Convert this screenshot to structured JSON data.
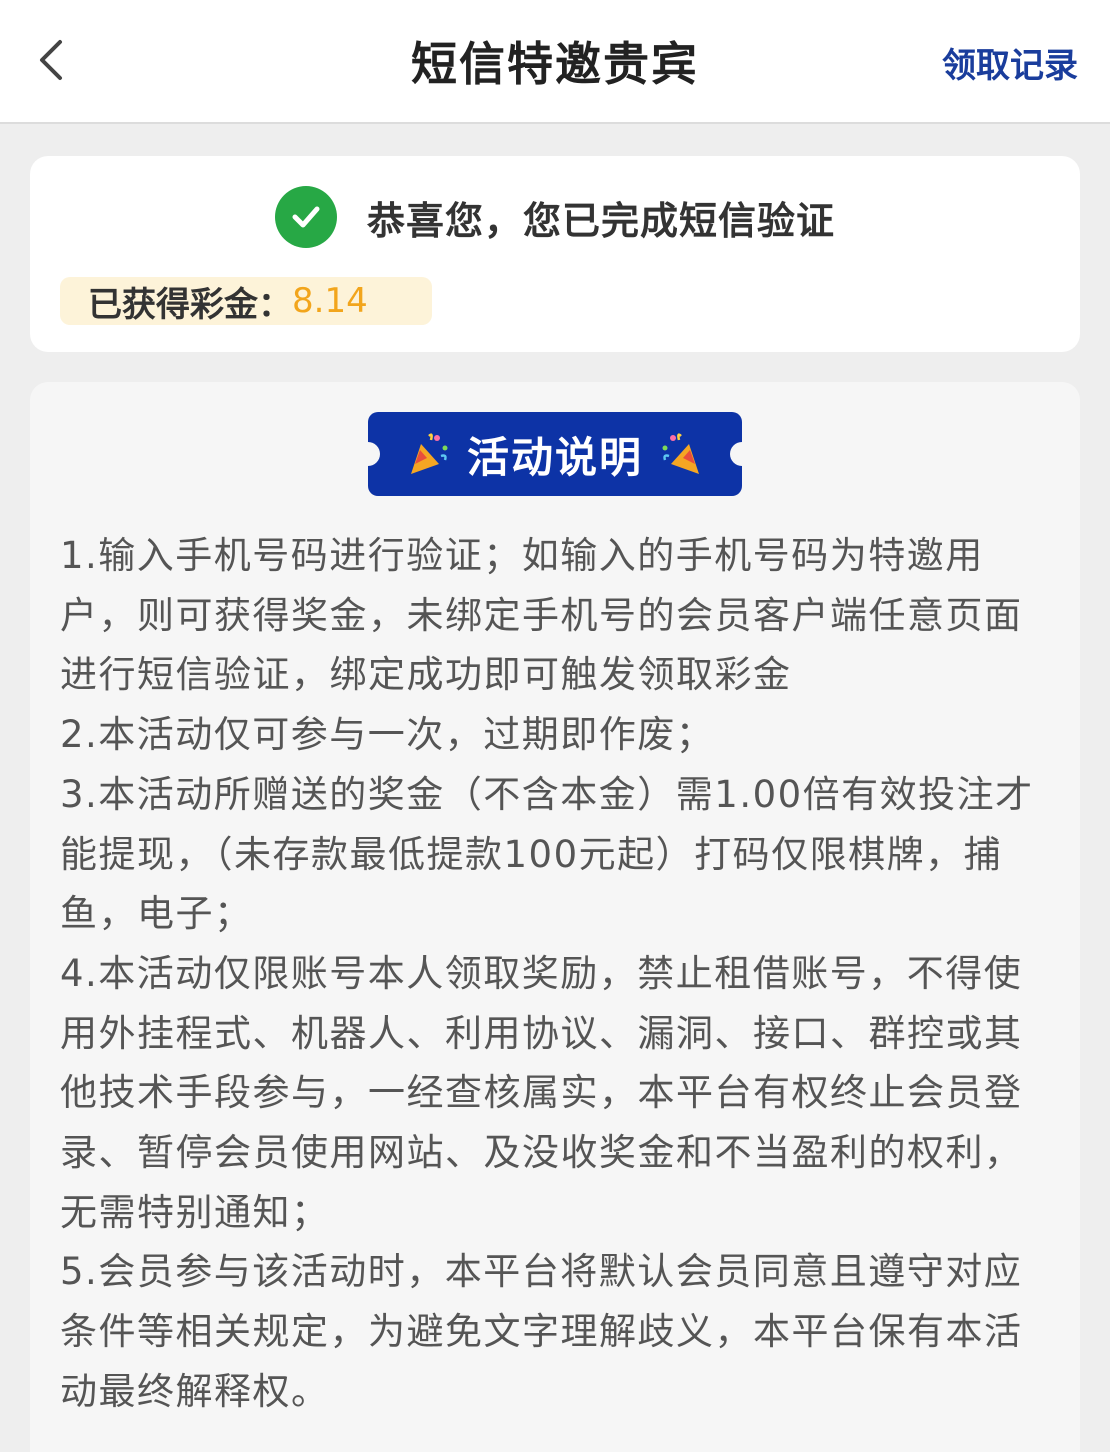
{
  "header": {
    "title": "短信特邀贵宾",
    "records_label": "领取记录",
    "back_icon": "chevron-left-icon"
  },
  "success": {
    "icon": "check-circle-icon",
    "message": "恭喜您，您已完成短信验证",
    "bonus_label": "已获得彩金：",
    "bonus_value": "8.14"
  },
  "rules": {
    "badge_label": "活动说明",
    "badge_icon": "party-popper-icon",
    "items": [
      "1.输入手机号码进行验证；如输入的手机号码为特邀用户，则可获得奖金，未绑定手机号的会员客户端任意页面进行短信验证，绑定成功即可触发领取彩金",
      "2.本活动仅可参与一次，过期即作废；",
      "3.本活动所赠送的奖金（不含本金）需1.00倍有效投注才能提现，（未存款最低提款100元起）打码仅限棋牌，捕鱼，电子；",
      "4.本活动仅限账号本人领取奖励，禁止租借账号，不得使用外挂程式、机器人、利用协议、漏洞、接口、群控或其他技术手段参与，一经查核属实，本平台有权终止会员登录、暂停会员使用网站、及没收奖金和不当盈利的权利，无需特别通知；",
      "5.会员参与该活动时，本平台将默认会员同意且遵守对应条件等相关规定，为避免文字理解歧义，本平台保有本活动最终解释权。"
    ]
  },
  "colors": {
    "accent_blue": "#0d33a6",
    "link_blue": "#1a3d9c",
    "success_green": "#27a845",
    "bonus_gold": "#f2a51c",
    "bonus_bg": "#fdf3d9"
  }
}
